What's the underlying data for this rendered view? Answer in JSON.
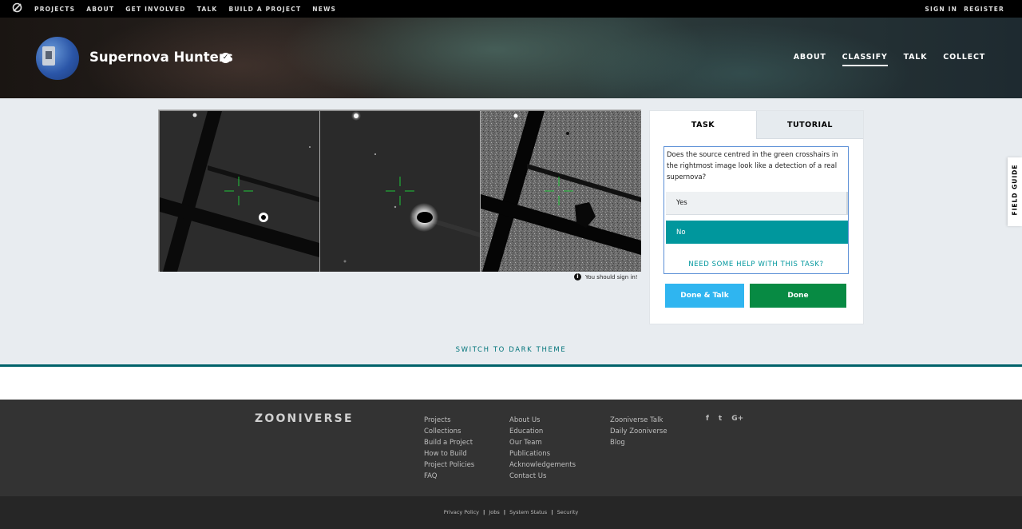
{
  "topnav": {
    "logo_icon": "zooniverse-logo-icon",
    "links": [
      "PROJECTS",
      "ABOUT",
      "GET INVOLVED",
      "TALK",
      "BUILD A PROJECT",
      "NEWS"
    ],
    "sign_in": "SIGN IN",
    "register": "REGISTER"
  },
  "project": {
    "title": "Supernova Hunters",
    "verified_icon": "checkmark-badge-icon",
    "nav": [
      "ABOUT",
      "CLASSIFY",
      "TALK",
      "COLLECT"
    ],
    "active_nav": "CLASSIFY"
  },
  "viewer": {
    "frames": 3,
    "signin_note": "You should sign in!"
  },
  "task": {
    "tabs": [
      "TASK",
      "TUTORIAL"
    ],
    "active_tab": "TASK",
    "question": "Does the source centred in the green crosshairs in the rightmost image look like a detection of a real supernova?",
    "answers": [
      "Yes",
      "No"
    ],
    "selected_answer": "No",
    "help": "NEED SOME HELP WITH THIS TASK?",
    "done_talk": "Done & Talk",
    "done": "Done"
  },
  "field_guide": "FIELD GUIDE",
  "switch_theme": "SWITCH TO DARK THEME",
  "footer": {
    "logo": "ZOONIVERSE",
    "col1": [
      "Projects",
      "Collections",
      "Build a Project",
      "How to Build",
      "Project Policies",
      "FAQ"
    ],
    "col2": [
      "About Us",
      "Education",
      "Our Team",
      "Publications",
      "Acknowledgements",
      "Contact Us"
    ],
    "col3": [
      "Zooniverse Talk",
      "Daily Zooniverse",
      "Blog"
    ],
    "social": [
      "f",
      "t",
      "G+"
    ],
    "legal": [
      "Privacy Policy",
      "Jobs",
      "System Status",
      "Security"
    ]
  },
  "colors": {
    "accent_teal": "#00979d",
    "done_green": "#078a43",
    "talk_blue": "#2fb5f0",
    "crosshair": "#1fc63a"
  }
}
